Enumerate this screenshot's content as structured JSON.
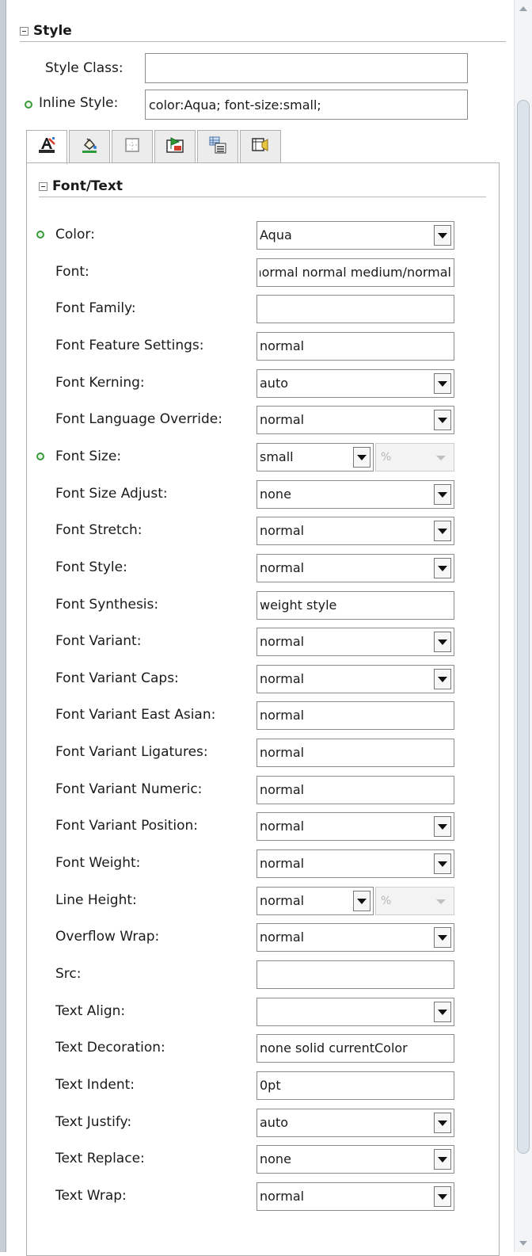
{
  "style_section": {
    "title": "Style",
    "style_class": {
      "label": "Style Class:",
      "value": ""
    },
    "inline_style": {
      "label": "Inline Style:",
      "value": "color:Aqua; font-size:small;",
      "has_value_indicator": true
    }
  },
  "tabs": [
    {
      "icon": "font-text-icon",
      "active": true
    },
    {
      "icon": "background-fill-icon",
      "active": false
    },
    {
      "icon": "border-box-icon",
      "active": false
    },
    {
      "icon": "position-layout-icon",
      "active": false
    },
    {
      "icon": "table-list-icon",
      "active": false
    },
    {
      "icon": "media-icon",
      "active": false
    }
  ],
  "font_text_section": {
    "title": "Font/Text",
    "properties": [
      {
        "label": "Color:",
        "value": "Aqua",
        "control": "dropdown",
        "set": true
      },
      {
        "label": "Font:",
        "value": "normal normal normal medium/normal",
        "control": "text"
      },
      {
        "label": "Font Family:",
        "value": "",
        "control": "text"
      },
      {
        "label": "Font Feature Settings:",
        "value": "normal",
        "control": "text"
      },
      {
        "label": "Font Kerning:",
        "value": "auto",
        "control": "dropdown"
      },
      {
        "label": "Font Language Override:",
        "value": "normal",
        "control": "dropdown"
      },
      {
        "label": "Font Size:",
        "value": "small",
        "control": "dropdown-unit",
        "unit": "%",
        "set": true
      },
      {
        "label": "Font Size Adjust:",
        "value": "none",
        "control": "dropdown"
      },
      {
        "label": "Font Stretch:",
        "value": "normal",
        "control": "dropdown"
      },
      {
        "label": "Font Style:",
        "value": "normal",
        "control": "dropdown"
      },
      {
        "label": "Font Synthesis:",
        "value": "weight style",
        "control": "text"
      },
      {
        "label": "Font Variant:",
        "value": "normal",
        "control": "dropdown"
      },
      {
        "label": "Font Variant Caps:",
        "value": "normal",
        "control": "dropdown"
      },
      {
        "label": "Font Variant East Asian:",
        "value": "normal",
        "control": "text"
      },
      {
        "label": "Font Variant Ligatures:",
        "value": "normal",
        "control": "text"
      },
      {
        "label": "Font Variant Numeric:",
        "value": "normal",
        "control": "text"
      },
      {
        "label": "Font Variant Position:",
        "value": "normal",
        "control": "dropdown"
      },
      {
        "label": "Font Weight:",
        "value": "normal",
        "control": "dropdown"
      },
      {
        "label": "Line Height:",
        "value": "normal",
        "control": "dropdown-unit",
        "unit": "%"
      },
      {
        "label": "Overflow Wrap:",
        "value": "normal",
        "control": "dropdown"
      },
      {
        "label": "Src:",
        "value": "",
        "control": "text"
      },
      {
        "label": "Text Align:",
        "value": "",
        "control": "dropdown"
      },
      {
        "label": "Text Decoration:",
        "value": "none solid currentColor",
        "control": "text"
      },
      {
        "label": "Text Indent:",
        "value": "0pt",
        "control": "text"
      },
      {
        "label": "Text Justify:",
        "value": "auto",
        "control": "dropdown"
      },
      {
        "label": "Text Replace:",
        "value": "none",
        "control": "dropdown"
      },
      {
        "label": "Text Wrap:",
        "value": "normal",
        "control": "dropdown"
      }
    ]
  }
}
